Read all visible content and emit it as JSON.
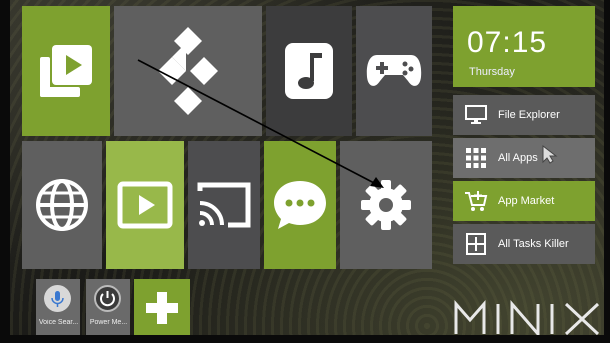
{
  "clock": {
    "time": "07:15",
    "day": "Thursday"
  },
  "side_menu": [
    {
      "label": "File Explorer",
      "icon": "monitor-icon"
    },
    {
      "label": "All Apps",
      "icon": "grid-icon"
    },
    {
      "label": "App Market",
      "icon": "cart-plus-icon"
    },
    {
      "label": "All Tasks Killer",
      "icon": "task-killer-icon"
    }
  ],
  "tiles": [
    {
      "id": "video-player",
      "icon": "video-library-icon"
    },
    {
      "id": "kodi",
      "icon": "kodi-logo-icon"
    },
    {
      "id": "music",
      "icon": "music-note-icon"
    },
    {
      "id": "games",
      "icon": "gamepad-icon"
    },
    {
      "id": "browser",
      "icon": "globe-icon"
    },
    {
      "id": "media-player",
      "icon": "play-icon"
    },
    {
      "id": "cast",
      "icon": "cast-icon"
    },
    {
      "id": "messages",
      "icon": "chat-bubble-icon"
    },
    {
      "id": "settings",
      "icon": "gear-icon"
    }
  ],
  "shortcuts": [
    {
      "label": "Voice Sear...",
      "icon": "microphone-icon"
    },
    {
      "label": "Power Me...",
      "icon": "power-icon"
    }
  ],
  "add_tile": {
    "icon": "plus-icon"
  },
  "brand": {
    "logo": "MINIX"
  },
  "colors": {
    "accent_green": "#7ea12f",
    "tile_gray": "#5f5f5f",
    "clock_text": "#ffffff"
  }
}
